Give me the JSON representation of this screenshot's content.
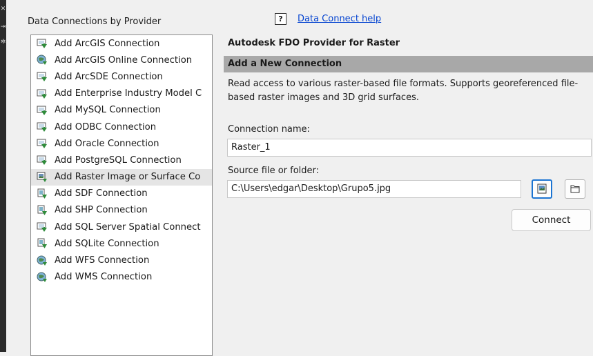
{
  "left_panel": {
    "title": "Data Connections by Provider",
    "items": [
      {
        "label": "Add ArcGIS Connection",
        "icon": "db-connection-icon"
      },
      {
        "label": "Add ArcGIS Online Connection",
        "icon": "globe-connection-icon"
      },
      {
        "label": "Add ArcSDE Connection",
        "icon": "db-connection-icon"
      },
      {
        "label": "Add Enterprise Industry Model C",
        "icon": "db-connection-icon"
      },
      {
        "label": "Add MySQL Connection",
        "icon": "db-connection-icon"
      },
      {
        "label": "Add ODBC Connection",
        "icon": "db-connection-icon"
      },
      {
        "label": "Add Oracle Connection",
        "icon": "db-connection-icon"
      },
      {
        "label": "Add PostgreSQL Connection",
        "icon": "db-connection-icon"
      },
      {
        "label": "Add Raster Image or Surface Co",
        "icon": "raster-connection-icon"
      },
      {
        "label": "Add SDF Connection",
        "icon": "file-connection-icon"
      },
      {
        "label": "Add SHP Connection",
        "icon": "file-connection-icon"
      },
      {
        "label": "Add SQL Server Spatial Connect",
        "icon": "db-connection-icon"
      },
      {
        "label": "Add SQLite Connection",
        "icon": "file-connection-icon"
      },
      {
        "label": "Add WFS Connection",
        "icon": "globe-connection-icon"
      },
      {
        "label": "Add WMS Connection",
        "icon": "globe-connection-icon"
      }
    ],
    "selected_index": 8
  },
  "help": {
    "icon": "?",
    "link_text": "Data Connect help"
  },
  "provider_title": "Autodesk FDO Provider for Raster",
  "section_title": "Add a New Connection",
  "description": "Read access to various raster-based file formats.  Supports georeferenced file-based raster images and 3D grid surfaces.",
  "connection_name": {
    "label": "Connection name:",
    "value": "Raster_1"
  },
  "source": {
    "label": "Source file or folder:",
    "value": "C:\\Users\\edgar\\Desktop\\Grupo5.jpg"
  },
  "connect_button": "Connect",
  "colors": {
    "link": "#0645d1",
    "section_bar": "#a8a8a8",
    "active_border": "#1b74d2"
  }
}
